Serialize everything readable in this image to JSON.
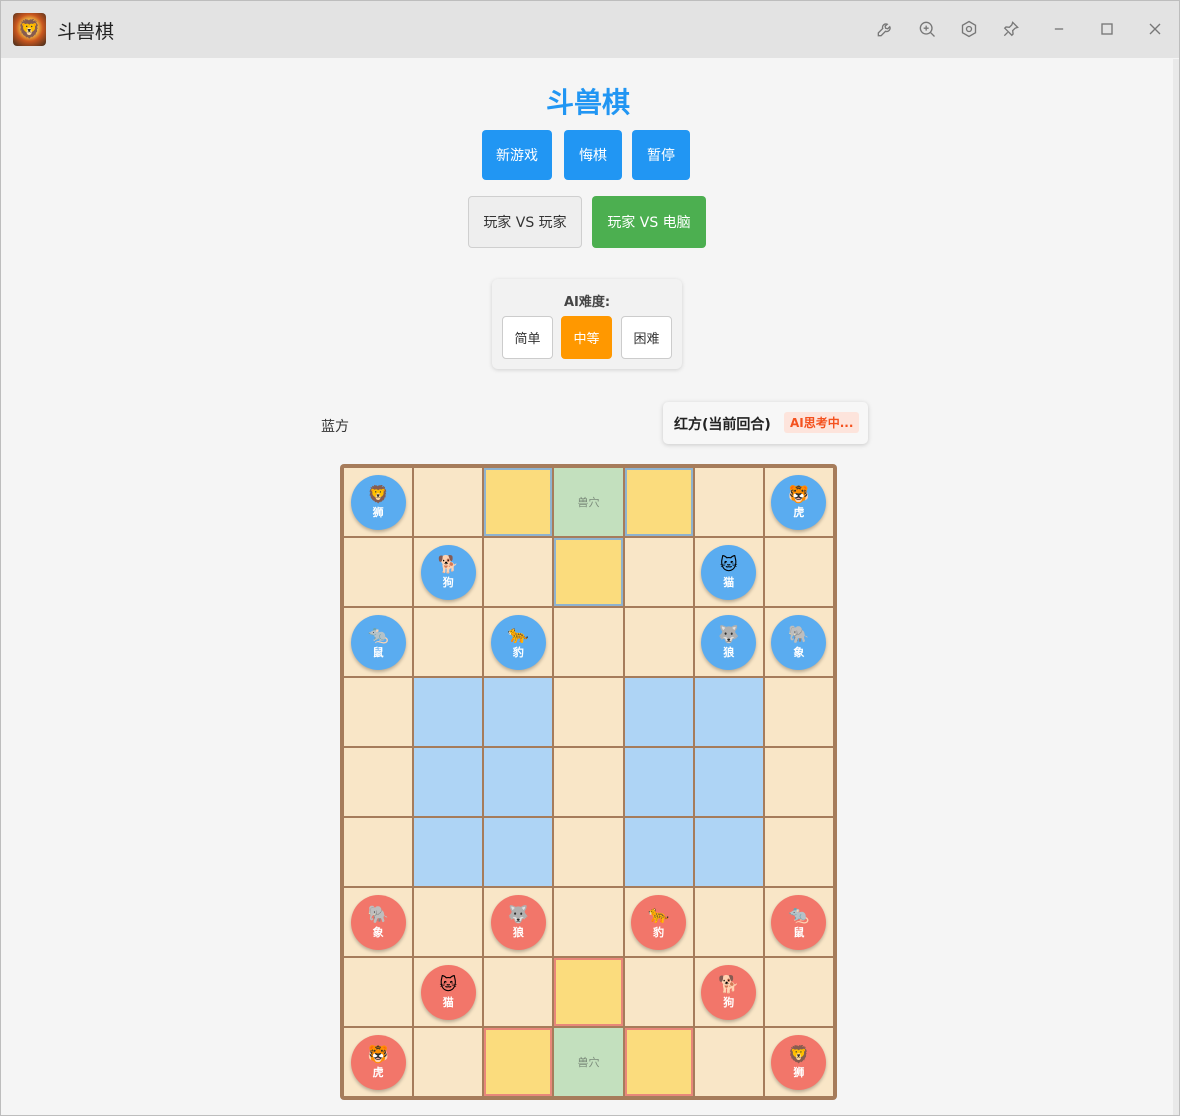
{
  "window": {
    "title": "斗兽棋",
    "toolbar_icons": [
      "wrench-icon",
      "zoom-in-icon",
      "settings-icon",
      "pin-icon",
      "minimize-icon",
      "maximize-icon",
      "close-icon"
    ]
  },
  "game": {
    "title": "斗兽棋",
    "buttons": {
      "new_game": "新游戏",
      "undo": "悔棋",
      "pause": "暂停"
    },
    "modes": {
      "pvp": "玩家 VS 玩家",
      "pve": "玩家 VS 电脑",
      "active": "pve"
    },
    "ai": {
      "label": "AI难度:",
      "easy": "简单",
      "medium": "中等",
      "hard": "困难",
      "active": "medium"
    },
    "players": {
      "blue": "蓝方",
      "red_current": "红方(当前回合)",
      "ai_status": "AI思考中..."
    },
    "board": {
      "rows": 9,
      "cols": 7,
      "den_label": "兽穴",
      "river_cells": [
        [
          3,
          1
        ],
        [
          3,
          2
        ],
        [
          3,
          4
        ],
        [
          3,
          5
        ],
        [
          4,
          1
        ],
        [
          4,
          2
        ],
        [
          4,
          4
        ],
        [
          4,
          5
        ],
        [
          5,
          1
        ],
        [
          5,
          2
        ],
        [
          5,
          4
        ],
        [
          5,
          5
        ]
      ],
      "traps": [
        {
          "row": 0,
          "col": 2,
          "side": "blue"
        },
        {
          "row": 0,
          "col": 4,
          "side": "blue"
        },
        {
          "row": 1,
          "col": 3,
          "side": "blue"
        },
        {
          "row": 8,
          "col": 2,
          "side": "red"
        },
        {
          "row": 8,
          "col": 4,
          "side": "red"
        },
        {
          "row": 7,
          "col": 3,
          "side": "red"
        }
      ],
      "dens": [
        {
          "row": 0,
          "col": 3,
          "side": "blue"
        },
        {
          "row": 8,
          "col": 3,
          "side": "red"
        }
      ],
      "pieces": [
        {
          "row": 0,
          "col": 0,
          "side": "blue",
          "name": "狮",
          "emoji": "🦁",
          "icon": "lion-icon"
        },
        {
          "row": 0,
          "col": 6,
          "side": "blue",
          "name": "虎",
          "emoji": "🐯",
          "icon": "tiger-icon"
        },
        {
          "row": 1,
          "col": 1,
          "side": "blue",
          "name": "狗",
          "emoji": "🐕",
          "icon": "dog-icon"
        },
        {
          "row": 1,
          "col": 5,
          "side": "blue",
          "name": "猫",
          "emoji": "🐱",
          "icon": "cat-icon"
        },
        {
          "row": 2,
          "col": 0,
          "side": "blue",
          "name": "鼠",
          "emoji": "🐀",
          "icon": "rat-icon"
        },
        {
          "row": 2,
          "col": 2,
          "side": "blue",
          "name": "豹",
          "emoji": "🐆",
          "icon": "leopard-icon"
        },
        {
          "row": 2,
          "col": 5,
          "side": "blue",
          "name": "狼",
          "emoji": "🐺",
          "icon": "wolf-icon"
        },
        {
          "row": 2,
          "col": 6,
          "side": "blue",
          "name": "象",
          "emoji": "🐘",
          "icon": "elephant-icon"
        },
        {
          "row": 6,
          "col": 0,
          "side": "red",
          "name": "象",
          "emoji": "🐘",
          "icon": "elephant-icon"
        },
        {
          "row": 6,
          "col": 2,
          "side": "red",
          "name": "狼",
          "emoji": "🐺",
          "icon": "wolf-icon"
        },
        {
          "row": 6,
          "col": 4,
          "side": "red",
          "name": "豹",
          "emoji": "🐆",
          "icon": "leopard-icon"
        },
        {
          "row": 6,
          "col": 6,
          "side": "red",
          "name": "鼠",
          "emoji": "🐀",
          "icon": "rat-icon"
        },
        {
          "row": 7,
          "col": 1,
          "side": "red",
          "name": "猫",
          "emoji": "🐱",
          "icon": "cat-icon"
        },
        {
          "row": 7,
          "col": 5,
          "side": "red",
          "name": "狗",
          "emoji": "🐕",
          "icon": "dog-icon"
        },
        {
          "row": 8,
          "col": 0,
          "side": "red",
          "name": "虎",
          "emoji": "🐯",
          "icon": "tiger-icon"
        },
        {
          "row": 8,
          "col": 6,
          "side": "red",
          "name": "狮",
          "emoji": "🦁",
          "icon": "lion-icon"
        }
      ]
    }
  }
}
